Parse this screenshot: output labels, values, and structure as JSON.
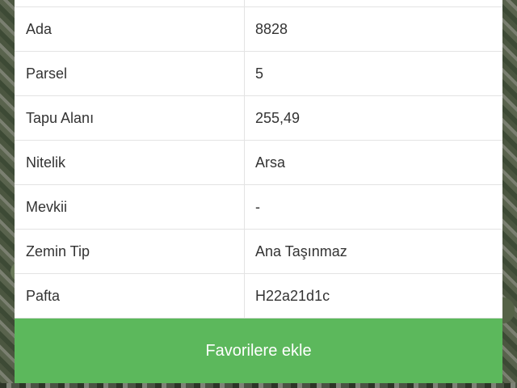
{
  "table": {
    "rows": [
      {
        "label": "Ada",
        "value": "8828"
      },
      {
        "label": "Parsel",
        "value": "5"
      },
      {
        "label": "Tapu Alanı",
        "value": "255,49"
      },
      {
        "label": "Nitelik",
        "value": "Arsa"
      },
      {
        "label": "Mevkii",
        "value": "-"
      },
      {
        "label": "Zemin Tip",
        "value": "Ana Taşınmaz"
      },
      {
        "label": "Pafta",
        "value": "H22a21d1c"
      }
    ]
  },
  "actions": {
    "favorite_label": "Favorilere ekle"
  },
  "colors": {
    "button_bg": "#5cb85c",
    "button_text": "#ffffff",
    "border": "#e3e3e3",
    "text": "#333333"
  }
}
